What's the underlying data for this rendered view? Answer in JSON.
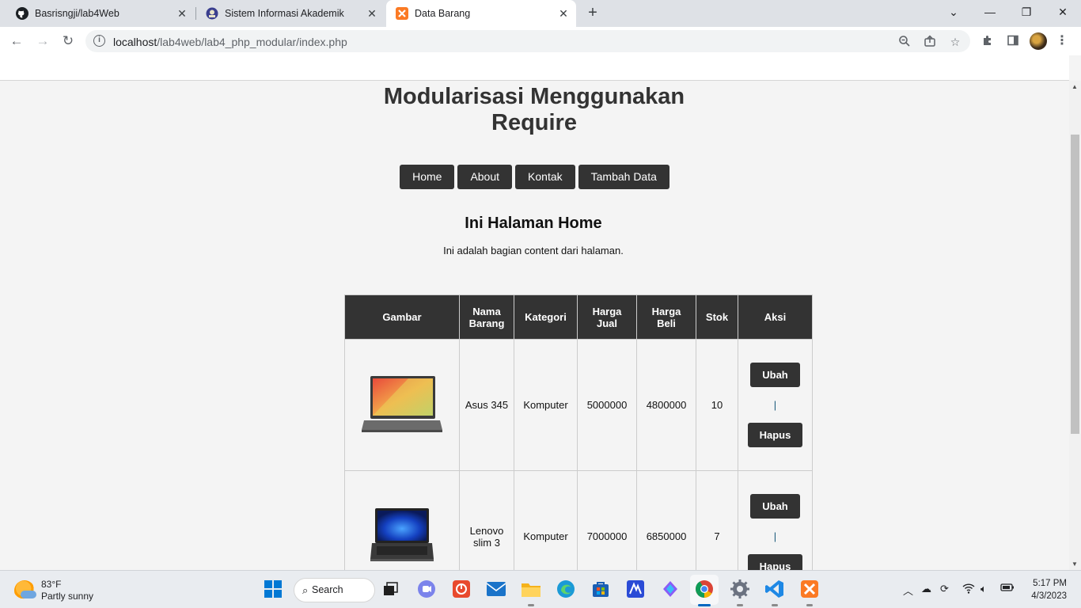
{
  "browser": {
    "tabs": [
      {
        "title": "Basrisngji/lab4Web",
        "icon": "github-icon"
      },
      {
        "title": "Sistem Informasi Akademik",
        "icon": "university-icon"
      },
      {
        "title": "Data Barang",
        "icon": "xampp-icon",
        "active": true
      }
    ],
    "url_host": "localhost",
    "url_path": "/lab4web/lab4_php_modular/index.php"
  },
  "page": {
    "title": "Modularisasi Menggunakan Require",
    "nav": [
      "Home",
      "About",
      "Kontak",
      "Tambah Data"
    ],
    "heading": "Ini Halaman Home",
    "description": "Ini adalah bagian content dari halaman.",
    "table": {
      "headers": [
        "Gambar",
        "Nama Barang",
        "Kategori",
        "Harga Jual",
        "Harga Beli",
        "Stok",
        "Aksi"
      ],
      "rows": [
        {
          "nama": "Asus 345",
          "kategori": "Komputer",
          "harga_jual": "5000000",
          "harga_beli": "4800000",
          "stok": "10",
          "edit": "Ubah",
          "sep": "|",
          "delete": "Hapus"
        },
        {
          "nama": "Lenovo slim 3",
          "kategori": "Komputer",
          "harga_jual": "7000000",
          "harga_beli": "6850000",
          "stok": "7",
          "edit": "Ubah",
          "sep": "|",
          "delete": "Hapus"
        }
      ]
    }
  },
  "taskbar": {
    "weather_temp": "83°F",
    "weather_desc": "Partly sunny",
    "search_label": "Search",
    "time": "5:17 PM",
    "date": "4/3/2023"
  }
}
